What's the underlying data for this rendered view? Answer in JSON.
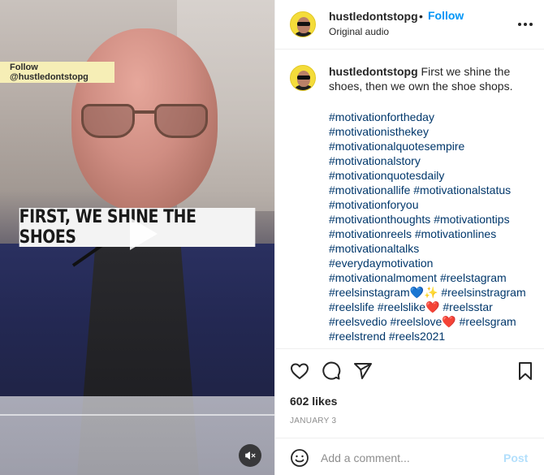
{
  "video": {
    "follow_tag": "Follow @hustledontstopg",
    "caption_text": "FIRST, WE SHINE THE SHOES"
  },
  "header": {
    "username": "hustledontstopg",
    "separator": "•",
    "follow_label": "Follow",
    "audio_label": "Original audio"
  },
  "post": {
    "username": "hustledontstopg",
    "caption": "First we shine the shoes, then we own the shoe shops.",
    "hashtag_lines": [
      "#motivationfortheday",
      "#motivationisthekey",
      "#motivationalquotesempire",
      "#motivationalstory",
      "#motivationquotesdaily",
      "#motivationallife #motivationalstatus",
      "#motivationforyou",
      "#motivationthoughts #motivationtips",
      "#motivationreels #motivationlines",
      "#motivationaltalks",
      "#everydaymotivation",
      "#motivationalmoment #reelstagram",
      "#reelsinstagram💙✨ #reelsinstragram",
      "#reelslife #reelslike❤️ #reelsstar",
      "#reelsvedio #reelslove❤️ #reelsgram",
      "#reelstrend #reels2021"
    ]
  },
  "stats": {
    "likes": "602 likes",
    "date": "JANUARY 3"
  },
  "comment": {
    "placeholder": "Add a comment...",
    "post_label": "Post"
  },
  "icons": {
    "play": "play-icon",
    "mute": "speaker-muted-icon",
    "more": "more-horizontal-icon",
    "like": "heart-icon",
    "comment": "comment-bubble-icon",
    "share": "paper-plane-icon",
    "save": "bookmark-icon",
    "emoji": "emoji-smile-icon"
  },
  "colors": {
    "follow_blue": "#0095f6",
    "post_disabled": "#b2dffc",
    "hashtag": "#00376b",
    "follow_tag_bg": "#f6eeb6"
  }
}
